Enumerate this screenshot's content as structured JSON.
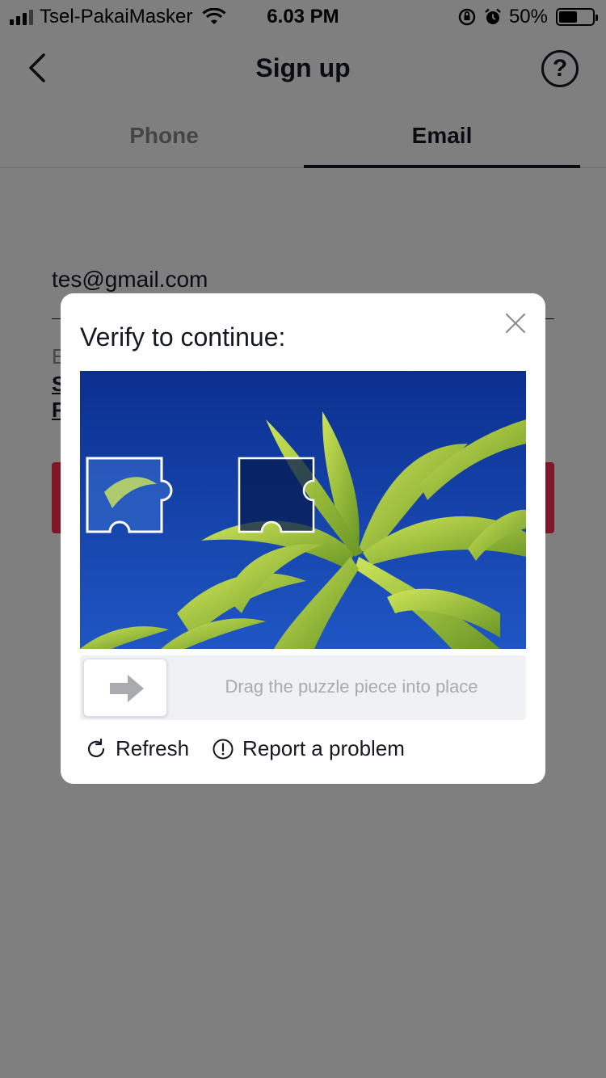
{
  "status_bar": {
    "carrier": "Tsel-PakaiMasker",
    "time": "6.03 PM",
    "battery": "50%",
    "battery_level": 0.5
  },
  "nav": {
    "title": "Sign up",
    "back_icon": "chevron-left-icon",
    "help_icon": "help-circle-icon",
    "help_glyph": "?"
  },
  "tabs": [
    {
      "label": "Phone",
      "active": false
    },
    {
      "label": "Email",
      "active": true
    }
  ],
  "form": {
    "email_value": "tes@gmail.com",
    "partial_text": "E",
    "link_partial_1": "S",
    "link_partial_2": "F",
    "primary_button_color": "#fe2c55"
  },
  "captcha": {
    "title": "Verify to continue:",
    "close_icon": "close-icon",
    "slider_hint": "Drag the puzzle piece into place",
    "slider_icon": "arrow-right-icon",
    "refresh_label": "Refresh",
    "refresh_icon": "refresh-icon",
    "report_label": "Report a problem",
    "report_icon": "alert-circle-icon"
  },
  "colors": {
    "overlay": "rgba(0,0,0,0.5)",
    "accent": "#fe2c55",
    "sky": "#0f3aa0"
  }
}
